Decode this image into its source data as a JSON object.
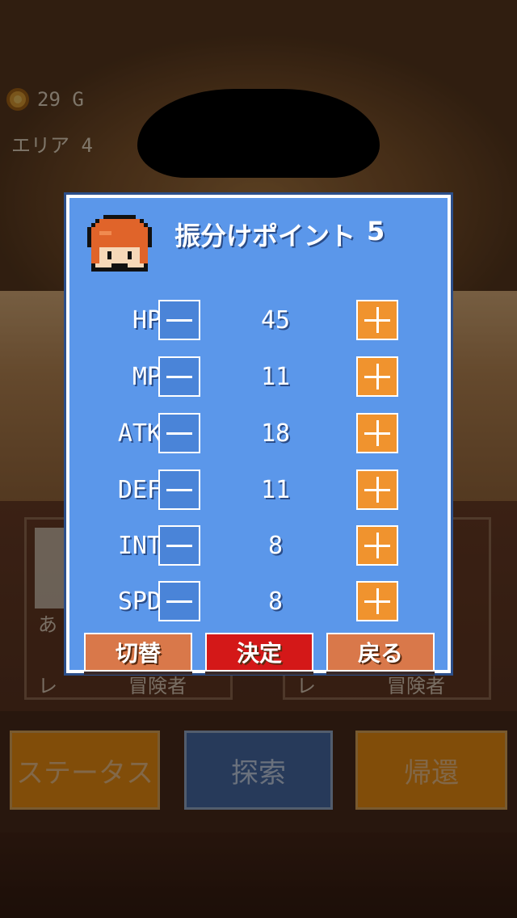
{
  "hud": {
    "gold": "29 G",
    "area": "エリア 4"
  },
  "party": [
    {
      "name": "あ",
      "level": "レ",
      "job": "冒険者"
    },
    {
      "name": "",
      "level": "レ",
      "job": "冒険者"
    }
  ],
  "bottom_buttons": {
    "status": "ステータス",
    "explore": "探索",
    "return": "帰還"
  },
  "dialog": {
    "points_label": "振分けポイント",
    "points_value": "5",
    "stats": [
      {
        "label": "HP",
        "value": "45"
      },
      {
        "label": "MP",
        "value": "11"
      },
      {
        "label": "ATK",
        "value": "18"
      },
      {
        "label": "DEF",
        "value": "11"
      },
      {
        "label": "INT",
        "value": "8"
      },
      {
        "label": "SPD",
        "value": "8"
      }
    ],
    "buttons": {
      "toggle": "切替",
      "decide": "決定",
      "back": "戻る"
    }
  },
  "colors": {
    "dialog_bg": "#5b97ea",
    "plus_button": "#f0932e",
    "decide_button": "#d41818",
    "toggle_back_button": "#d9784a"
  },
  "icons": {
    "coin": "coin-icon",
    "hero": "hero-portrait",
    "minus": "minus-icon",
    "plus": "plus-icon"
  }
}
